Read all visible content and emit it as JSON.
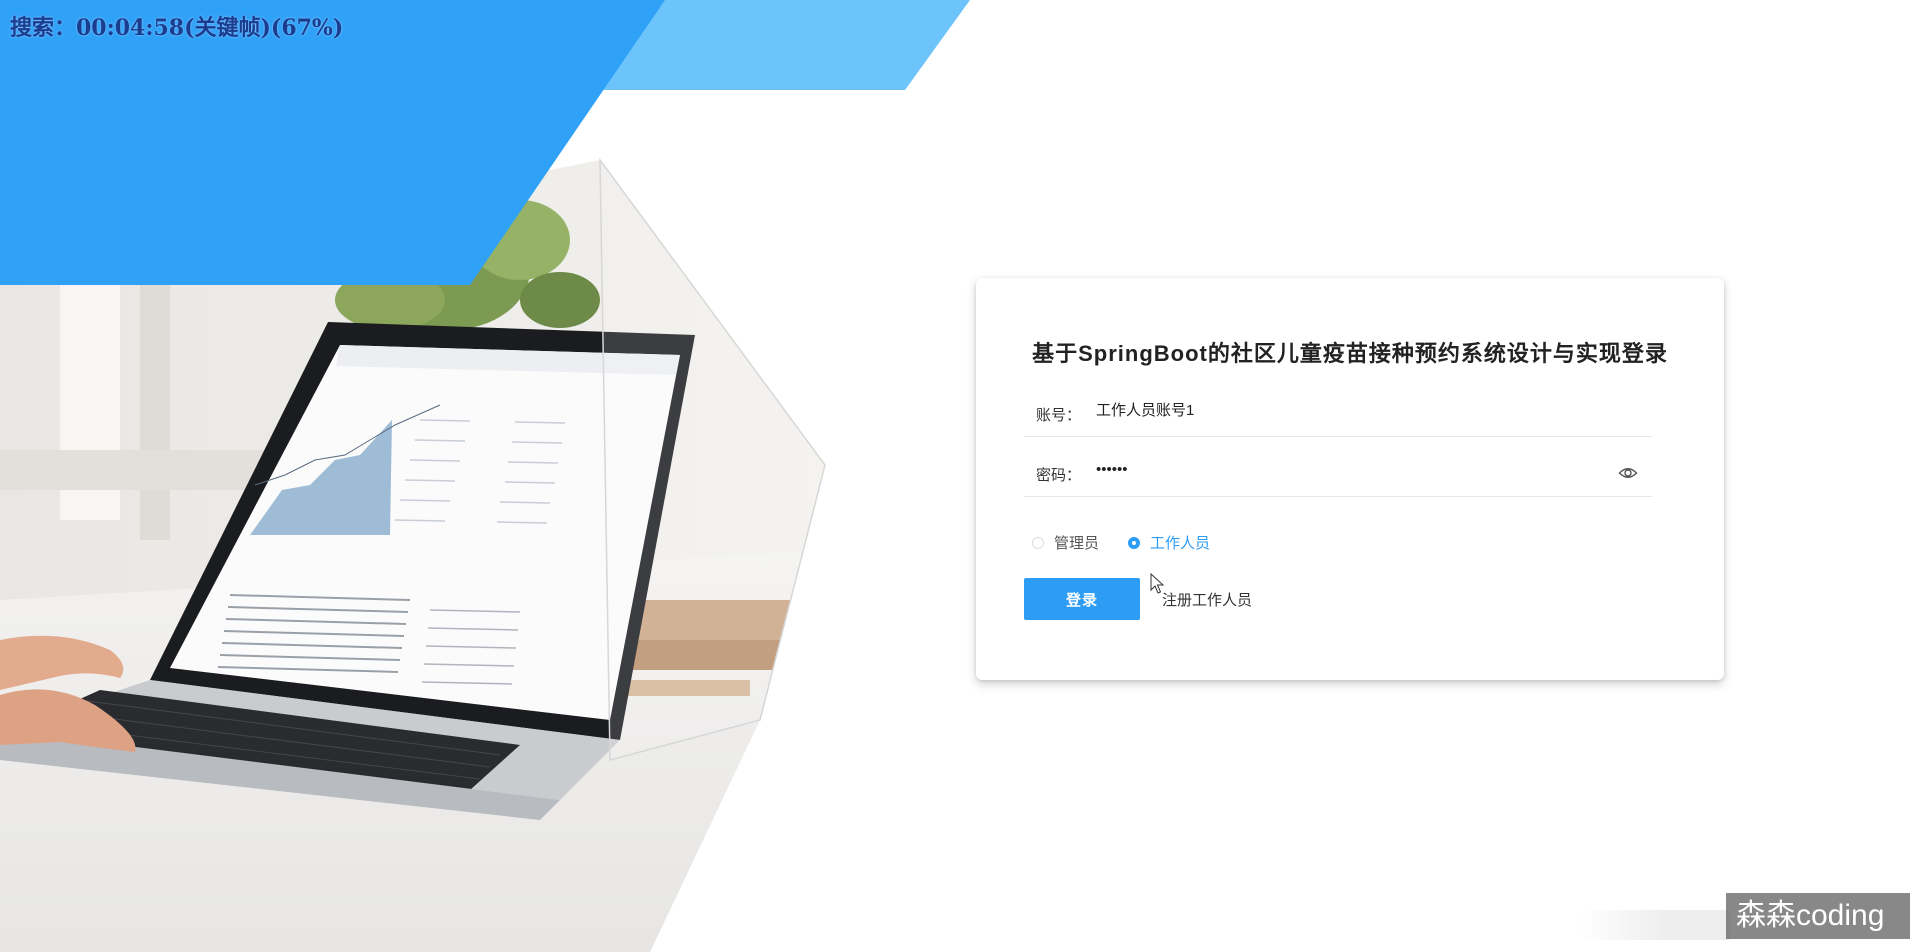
{
  "overlay": {
    "text": "搜索：00:04:58(关键帧)(67%)"
  },
  "login": {
    "title": "基于SpringBoot的社区儿童疫苗接种预约系统设计与实现登录",
    "account_label": "账号：",
    "account_value": "工作人员账号1",
    "password_label": "密码：",
    "password_value": "••••••",
    "roles": [
      {
        "label": "管理员",
        "checked": false
      },
      {
        "label": "工作人员",
        "checked": true
      }
    ],
    "login_button": "登录",
    "register_link": "注册工作人员"
  },
  "watermark": {
    "text": "森森coding"
  },
  "colors": {
    "primary": "#2d9cf5",
    "banner_blue": "#2fa2f7",
    "banner_light_blue": "#6cc4fb"
  }
}
